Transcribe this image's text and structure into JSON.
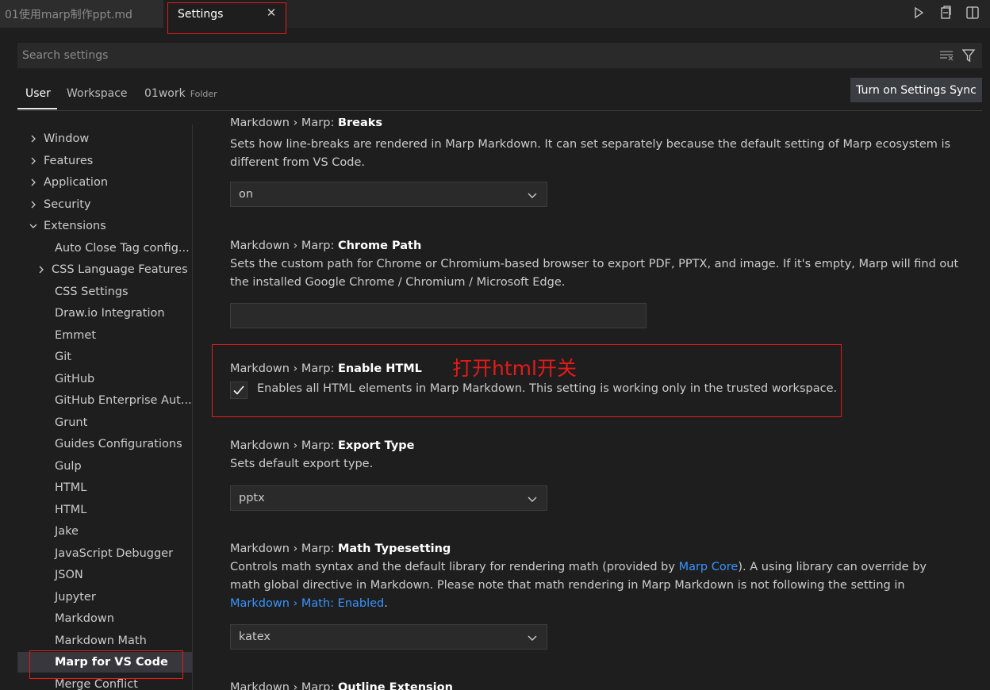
{
  "tabs": {
    "inactive_label": "01使用marp制作ppt.md",
    "active_label": "Settings",
    "actions": [
      "play-icon",
      "open-preview-icon",
      "split-editor-icon"
    ]
  },
  "search": {
    "placeholder": "Search settings",
    "value": ""
  },
  "scopes": {
    "user": "User",
    "workspace": "Workspace",
    "folder": "01work",
    "folder_tag": "Folder",
    "sync_button": "Turn on Settings Sync"
  },
  "toc": [
    {
      "label": "Window",
      "chevron": "right",
      "indent": 0
    },
    {
      "label": "Features",
      "chevron": "right",
      "indent": 0
    },
    {
      "label": "Application",
      "chevron": "right",
      "indent": 0
    },
    {
      "label": "Security",
      "chevron": "right",
      "indent": 0
    },
    {
      "label": "Extensions",
      "chevron": "down",
      "indent": 0
    },
    {
      "label": "Auto Close Tag config...",
      "chevron": "",
      "indent": 1
    },
    {
      "label": "CSS Language Features",
      "chevron": "right",
      "indent": 1
    },
    {
      "label": "CSS Settings",
      "chevron": "",
      "indent": 1
    },
    {
      "label": "Draw.io Integration",
      "chevron": "",
      "indent": 1
    },
    {
      "label": "Emmet",
      "chevron": "",
      "indent": 1
    },
    {
      "label": "Git",
      "chevron": "",
      "indent": 1
    },
    {
      "label": "GitHub",
      "chevron": "",
      "indent": 1
    },
    {
      "label": "GitHub Enterprise Aut...",
      "chevron": "",
      "indent": 1
    },
    {
      "label": "Grunt",
      "chevron": "",
      "indent": 1
    },
    {
      "label": "Guides Configurations",
      "chevron": "",
      "indent": 1
    },
    {
      "label": "Gulp",
      "chevron": "",
      "indent": 1
    },
    {
      "label": "HTML",
      "chevron": "",
      "indent": 1
    },
    {
      "label": "HTML",
      "chevron": "",
      "indent": 1
    },
    {
      "label": "Jake",
      "chevron": "",
      "indent": 1
    },
    {
      "label": "JavaScript Debugger",
      "chevron": "",
      "indent": 1
    },
    {
      "label": "JSON",
      "chevron": "",
      "indent": 1
    },
    {
      "label": "Jupyter",
      "chevron": "",
      "indent": 1
    },
    {
      "label": "Markdown",
      "chevron": "",
      "indent": 1
    },
    {
      "label": "Markdown Math",
      "chevron": "",
      "indent": 1
    },
    {
      "label": "Marp for VS Code",
      "chevron": "",
      "indent": 1,
      "selected": true
    },
    {
      "label": "Merge Conflict",
      "chevron": "",
      "indent": 1
    }
  ],
  "settings": {
    "breaks": {
      "prefix": "Markdown › Marp: ",
      "name": "Breaks",
      "desc": "Sets how line-breaks are rendered in Marp Markdown. It can set separately because the default setting of Marp ecosystem is different from VS Code.",
      "value": "on"
    },
    "chrome_path": {
      "prefix": "Markdown › Marp: ",
      "name": "Chrome Path",
      "desc": "Sets the custom path for Chrome or Chromium-based browser to export PDF, PPTX, and image. If it's empty, Marp will find out the installed Google Chrome / Chromium / Microsoft Edge.",
      "value": ""
    },
    "enable_html": {
      "prefix": "Markdown › Marp: ",
      "name": "Enable HTML",
      "desc": "Enables all HTML elements in Marp Markdown. This setting is working only in the trusted workspace.",
      "checked": true,
      "annotation": "打开html开关"
    },
    "export_type": {
      "prefix": "Markdown › Marp: ",
      "name": "Export Type",
      "desc": "Sets default export type.",
      "value": "pptx"
    },
    "math": {
      "prefix": "Markdown › Marp: ",
      "name": "Math Typesetting",
      "desc_1": "Controls math syntax and the default library for rendering math (provided by ",
      "link_1": "Marp Core",
      "desc_2": "). A using library can override by math global directive in Markdown. Please note that math rendering in Marp Markdown is not following the setting in ",
      "link_2": "Markdown › Math: Enabled",
      "desc_3": ".",
      "value": "katex"
    },
    "outline": {
      "prefix": "Markdown › Marp: ",
      "name": "Outline Extension"
    }
  },
  "colors": {
    "annotation_red": "#e51a1a",
    "link_blue": "#3794ff",
    "modified_bar": "#0c7d9d"
  }
}
